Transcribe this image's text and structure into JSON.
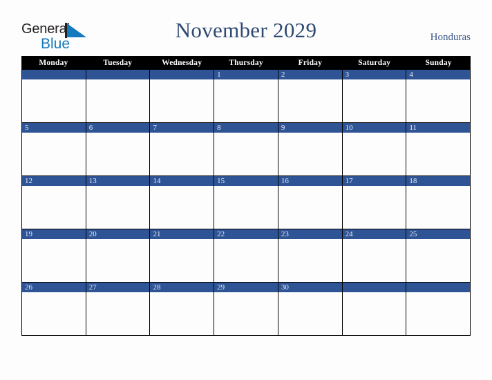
{
  "brand": {
    "word1": "General",
    "word2": "Blue",
    "triangle_color": "#1479bd",
    "word1_color": "#231f20",
    "word2_color": "#1479bd"
  },
  "header": {
    "title": "November 2029",
    "country": "Honduras",
    "title_color": "#2e4a72",
    "country_color": "#3b5688"
  },
  "calendar": {
    "accent_color": "#2f5496",
    "header_bg": "#000000",
    "day_names": [
      "Monday",
      "Tuesday",
      "Wednesday",
      "Thursday",
      "Friday",
      "Saturday",
      "Sunday"
    ],
    "weeks": [
      [
        "",
        "",
        "",
        "1",
        "2",
        "3",
        "4"
      ],
      [
        "5",
        "6",
        "7",
        "8",
        "9",
        "10",
        "11"
      ],
      [
        "12",
        "13",
        "14",
        "15",
        "16",
        "17",
        "18"
      ],
      [
        "19",
        "20",
        "21",
        "22",
        "23",
        "24",
        "25"
      ],
      [
        "26",
        "27",
        "28",
        "29",
        "30",
        "",
        ""
      ]
    ]
  }
}
